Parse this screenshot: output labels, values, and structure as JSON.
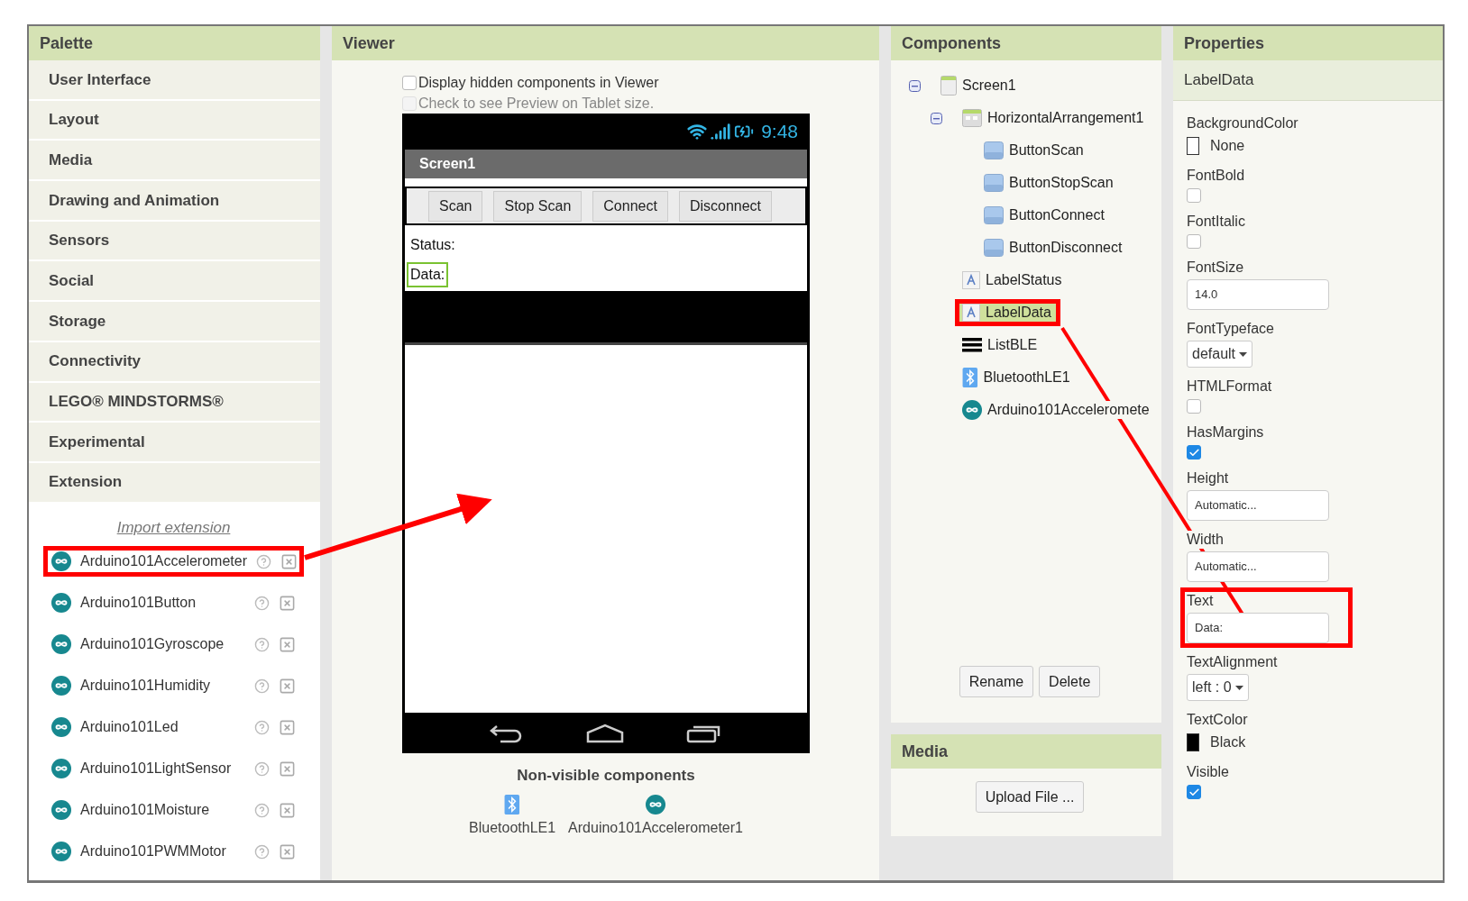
{
  "palette": {
    "title": "Palette",
    "categories": [
      "User Interface",
      "Layout",
      "Media",
      "Drawing and Animation",
      "Sensors",
      "Social",
      "Storage",
      "Connectivity",
      "LEGO® MINDSTORMS®",
      "Experimental",
      "Extension"
    ],
    "import_link": "Import extension",
    "extensions": [
      {
        "name": "Arduino101Accelerometer",
        "highlighted": true
      },
      {
        "name": "Arduino101Button",
        "highlighted": false
      },
      {
        "name": "Arduino101Gyroscope",
        "highlighted": false
      },
      {
        "name": "Arduino101Humidity",
        "highlighted": false
      },
      {
        "name": "Arduino101Led",
        "highlighted": false
      },
      {
        "name": "Arduino101LightSensor",
        "highlighted": false
      },
      {
        "name": "Arduino101Moisture",
        "highlighted": false
      },
      {
        "name": "Arduino101PWMMotor",
        "highlighted": false
      }
    ]
  },
  "viewer": {
    "title": "Viewer",
    "options": [
      {
        "label": "Display hidden components in Viewer",
        "checked": false,
        "disabled": false
      },
      {
        "label": "Check to see Preview on Tablet size.",
        "checked": false,
        "disabled": true
      }
    ],
    "phone": {
      "time": "9:48",
      "screen_title": "Screen1",
      "buttons": [
        "Scan",
        "Stop Scan",
        "Connect",
        "Disconnect"
      ],
      "labels": [
        {
          "text": "Status:",
          "selected": false
        },
        {
          "text": "Data:",
          "selected": true
        }
      ]
    },
    "nonvisible": {
      "title": "Non-visible components",
      "items": [
        {
          "kind": "bluetooth",
          "name": "BluetoothLE1"
        },
        {
          "kind": "arduino",
          "name": "Arduino101Accelerometer1"
        }
      ]
    }
  },
  "components": {
    "title": "Components",
    "tree": [
      {
        "kind": "screen",
        "name": "Screen1",
        "expanded": true,
        "selected": false,
        "highlighted": false,
        "children": [
          {
            "kind": "arrangement",
            "name": "HorizontalArrangement1",
            "expanded": true,
            "selected": false,
            "highlighted": false,
            "children": [
              {
                "kind": "button",
                "name": "ButtonScan",
                "selected": false,
                "highlighted": false
              },
              {
                "kind": "button",
                "name": "ButtonStopScan",
                "selected": false,
                "highlighted": false
              },
              {
                "kind": "button",
                "name": "ButtonConnect",
                "selected": false,
                "highlighted": false
              },
              {
                "kind": "button",
                "name": "ButtonDisconnect",
                "selected": false,
                "highlighted": false
              }
            ]
          },
          {
            "kind": "label",
            "name": "LabelStatus",
            "selected": false,
            "highlighted": false
          },
          {
            "kind": "label",
            "name": "LabelData",
            "selected": true,
            "highlighted": true
          },
          {
            "kind": "list",
            "name": "ListBLE",
            "selected": false,
            "highlighted": false
          },
          {
            "kind": "bluetooth",
            "name": "BluetoothLE1",
            "selected": false,
            "highlighted": false
          },
          {
            "kind": "arduino",
            "name": "Arduino101Acceleromete",
            "selected": false,
            "highlighted": false
          }
        ]
      }
    ],
    "buttons": [
      "Rename",
      "Delete"
    ]
  },
  "media": {
    "title": "Media",
    "button": "Upload File ..."
  },
  "properties": {
    "title": "Properties",
    "component": "LabelData",
    "items": [
      {
        "kind": "color",
        "label": "BackgroundColor",
        "value": "None",
        "highlighted": false
      },
      {
        "kind": "checkbox",
        "label": "FontBold",
        "checked": false,
        "highlighted": false
      },
      {
        "kind": "checkbox",
        "label": "FontItalic",
        "checked": false,
        "highlighted": false
      },
      {
        "kind": "textbox",
        "label": "FontSize",
        "value": "14.0",
        "highlighted": false
      },
      {
        "kind": "dropdown",
        "label": "FontTypeface",
        "value": "default",
        "highlighted": false
      },
      {
        "kind": "checkbox",
        "label": "HTMLFormat",
        "checked": false,
        "highlighted": false
      },
      {
        "kind": "checkbox",
        "label": "HasMargins",
        "checked": true,
        "highlighted": false
      },
      {
        "kind": "textbox",
        "label": "Height",
        "value": "Automatic...",
        "highlighted": false
      },
      {
        "kind": "textbox",
        "label": "Width",
        "value": "Automatic...",
        "highlighted": false
      },
      {
        "kind": "textbox",
        "label": "Text",
        "value": "Data:",
        "highlighted": true
      },
      {
        "kind": "dropdown",
        "label": "TextAlignment",
        "value": "left : 0",
        "highlighted": false
      },
      {
        "kind": "color",
        "label": "TextColor",
        "value": "Black",
        "color": "#000000",
        "highlighted": false
      },
      {
        "kind": "checkbox",
        "label": "Visible",
        "checked": true,
        "highlighted": false
      }
    ]
  }
}
